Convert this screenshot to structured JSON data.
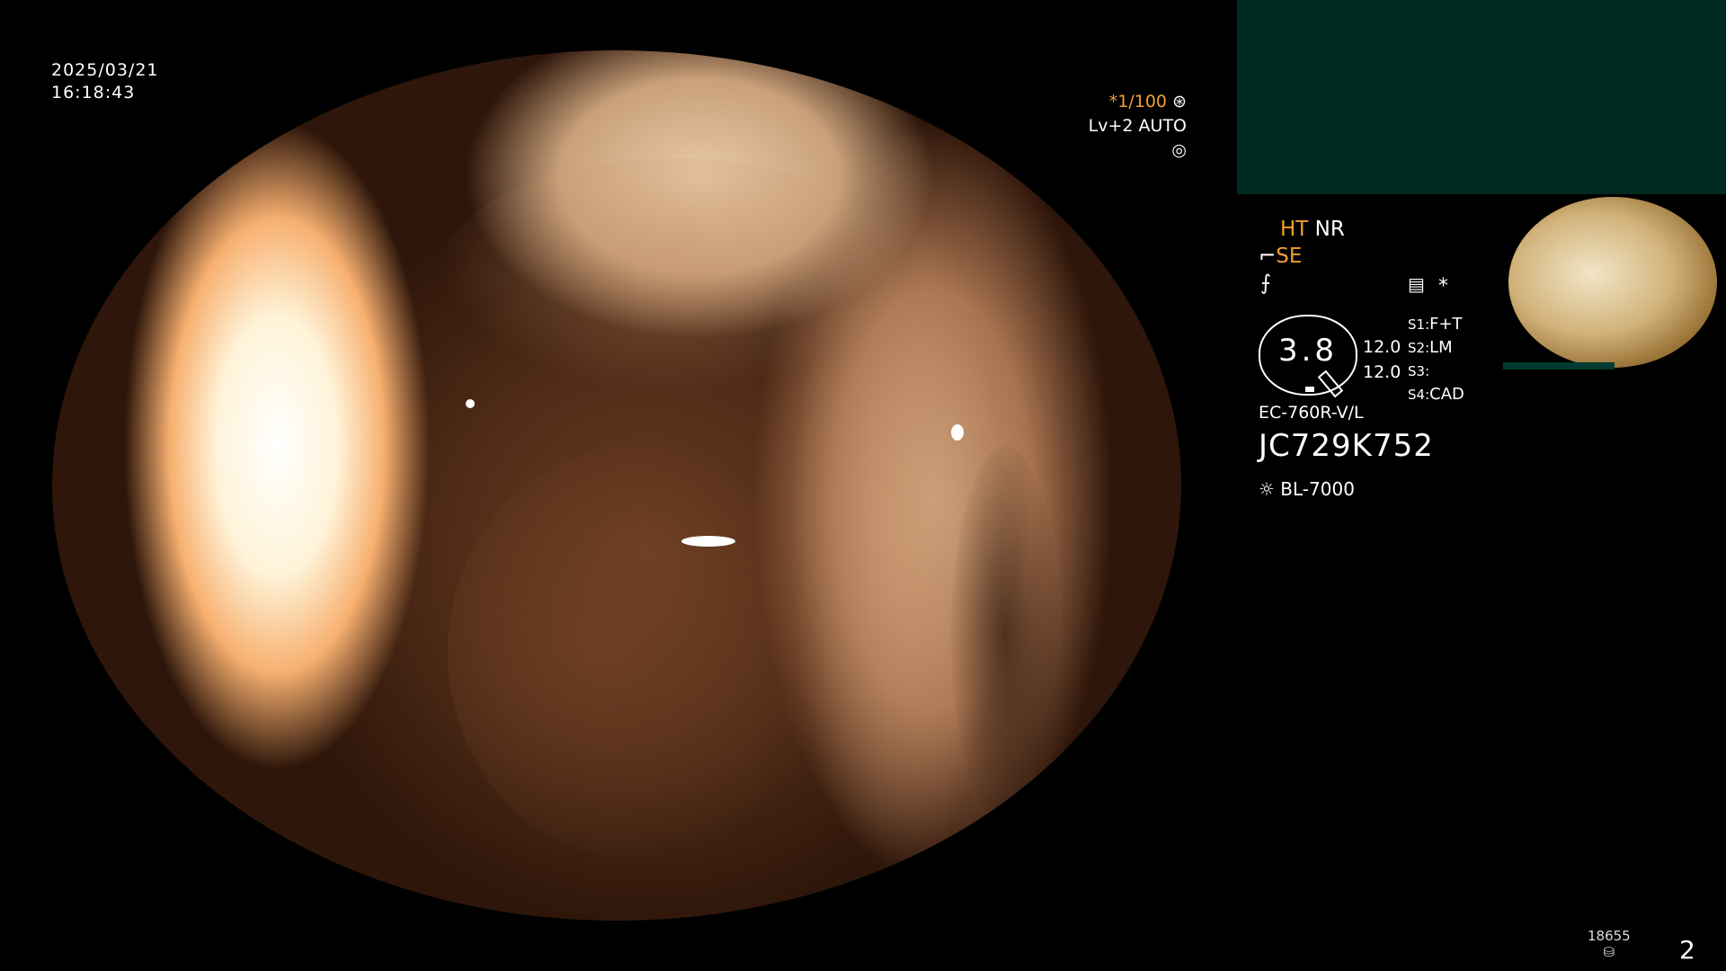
{
  "overlay": {
    "date": "2025/03/21",
    "time": "16:18:43",
    "shutter": "*1/100",
    "iris": "Lv+2 AUTO"
  },
  "settings": {
    "ht": "HT",
    "nr": "NR",
    "se": "SE",
    "gauge_value": "3.8",
    "value_1": "12.0",
    "value_2": "12.0",
    "s1_label": "S1:",
    "s1_value": "F+T",
    "s2_label": "S2:",
    "s2_value": "LM",
    "s3_label": "S3:",
    "s3_value": "",
    "s4_label": "S4:",
    "s4_value": "CAD"
  },
  "device": {
    "model": "EC-760R-V/L",
    "serial": "JC729K752",
    "light_source": "BL-7000"
  },
  "footer": {
    "counter": "18655",
    "page_number": "2"
  },
  "icons": [
    "shutter-icon",
    "iris-icon",
    "scope-icon",
    "filter-icon",
    "menu-icon",
    "asterisk-icon",
    "light-icon",
    "storage-icon"
  ],
  "colors": {
    "accent": "#f0a030",
    "panel": "#002a22"
  }
}
